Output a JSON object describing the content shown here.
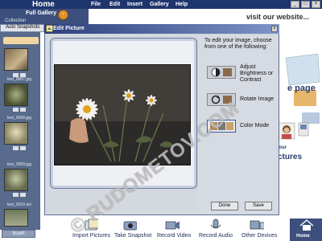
{
  "app": {
    "title": "Home"
  },
  "menu": [
    "File",
    "Edit",
    "Insert",
    "Gallery",
    "Help"
  ],
  "window_buttons": [
    "_",
    "□",
    "×"
  ],
  "gallery": {
    "title": "Full Gallery",
    "collection_label": "Collection",
    "tab_label": "Auto Snapshots",
    "insert_label": "Insert"
  },
  "thumbnails": [
    {
      "caption": ""
    },
    {
      "caption": "test_0007.jpg"
    },
    {
      "caption": "test_0008.jpg"
    },
    {
      "caption": "test_0009.jpg"
    },
    {
      "caption": "test_0010.avi"
    }
  ],
  "web": {
    "visit": "visit our website...",
    "page_text": "e page",
    "your_text": "your",
    "pictures_text": "ctures"
  },
  "dialog": {
    "title": "Edit Picture",
    "close": "×",
    "instructions": "To edit your image, choose from one of the following:",
    "options": [
      {
        "label": "Adjust Brightness or Contrast",
        "icon": "brightness-contrast-icon"
      },
      {
        "label": "Rotate Image",
        "icon": "rotate-icon"
      },
      {
        "label": "Color Mode",
        "icon": "color-mode-icon"
      }
    ],
    "done_label": "Done",
    "save_label": "Save"
  },
  "bottom_toolbar": [
    {
      "label": "Import Pictures",
      "icon": "import-pictures-icon"
    },
    {
      "label": "Take Snapshot",
      "icon": "camera-icon"
    },
    {
      "label": "Record Video",
      "icon": "video-camera-icon"
    },
    {
      "label": "Record Audio",
      "icon": "microphone-icon"
    },
    {
      "label": "Other Devices",
      "icon": "devices-icon"
    },
    {
      "label": "Home",
      "icon": "home-icon"
    }
  ],
  "watermark": "© RUDOMETOV.COM",
  "colors": {
    "titlebar": "#1f356e",
    "sidebar": "#586b8c",
    "accent": "#e0912b"
  }
}
